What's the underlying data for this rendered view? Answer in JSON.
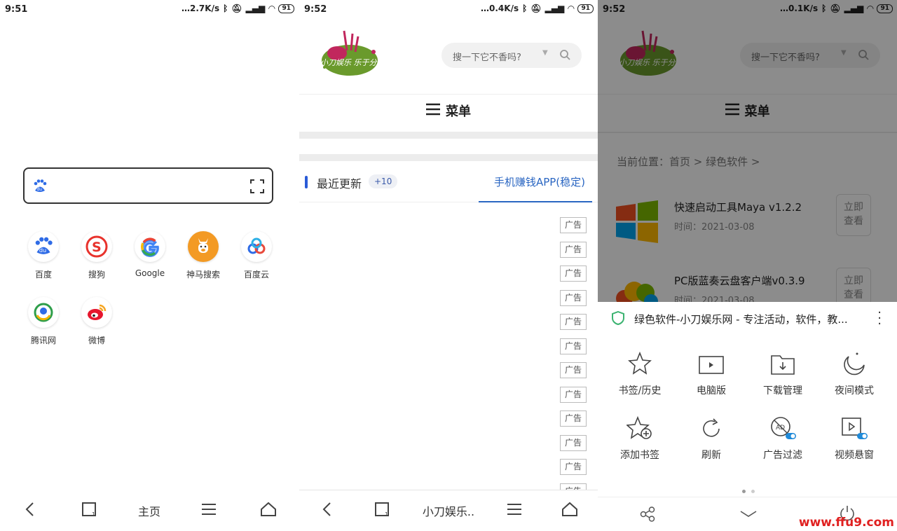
{
  "screen1": {
    "status": {
      "time": "9:51",
      "speed": "…2.7K/s",
      "battery": "91"
    },
    "apps": [
      {
        "label": "百度",
        "icon": "baidu-paw-icon"
      },
      {
        "label": "搜狗",
        "icon": "sogou-icon"
      },
      {
        "label": "Google",
        "icon": "google-icon"
      },
      {
        "label": "神马搜索",
        "icon": "shenma-llama-icon"
      },
      {
        "label": "百度云",
        "icon": "baidu-cloud-icon"
      },
      {
        "label": "腾讯网",
        "icon": "tencent-news-icon"
      },
      {
        "label": "微博",
        "icon": "weibo-icon"
      }
    ],
    "nav": {
      "home": "主页"
    }
  },
  "screen2": {
    "status": {
      "time": "9:52",
      "speed": "…0.4K/s",
      "battery": "91"
    },
    "search_placeholder": "搜一下它不香吗?",
    "menu": "菜单",
    "tab_recent": "最近更新",
    "tab_recent_badge": "+10",
    "tab_active": "手机赚钱APP(稳定)",
    "ad_label": "广告",
    "nav": {
      "page_title": "小刀娱乐.."
    }
  },
  "screen3": {
    "status": {
      "time": "9:52",
      "speed": "…0.1K/s",
      "battery": "91"
    },
    "search_placeholder": "搜一下它不香吗?",
    "menu": "菜单",
    "breadcrumb": "当前位置：首页 > 绿色软件 >",
    "items": [
      {
        "title": "快速启动工具Maya v1.2.2",
        "date": "时间：2021-03-08",
        "btn": "立即查看"
      },
      {
        "title": "PC版蓝奏云盘客户端v0.3.9",
        "date": "时间：2021-03-08",
        "btn": "立即查看"
      }
    ],
    "sheet_title": "绿色软件-小刀娱乐网 - 专注活动，软件，教...",
    "options": [
      {
        "label": "书签/历史",
        "icon": "bookmark-star-icon"
      },
      {
        "label": "电脑版",
        "icon": "desktop-mode-icon"
      },
      {
        "label": "下载管理",
        "icon": "download-folder-icon"
      },
      {
        "label": "夜间模式",
        "icon": "night-moon-icon"
      },
      {
        "label": "添加书签",
        "icon": "add-bookmark-icon"
      },
      {
        "label": "刷新",
        "icon": "refresh-icon"
      },
      {
        "label": "广告过滤",
        "icon": "ad-filter-icon"
      },
      {
        "label": "视频悬窗",
        "icon": "video-float-icon"
      }
    ]
  },
  "watermark": "www.ffu9.com",
  "colors": {
    "accent_blue": "#2a66c2",
    "watermark_red": "#e02020",
    "shield_green": "#3cb371"
  }
}
